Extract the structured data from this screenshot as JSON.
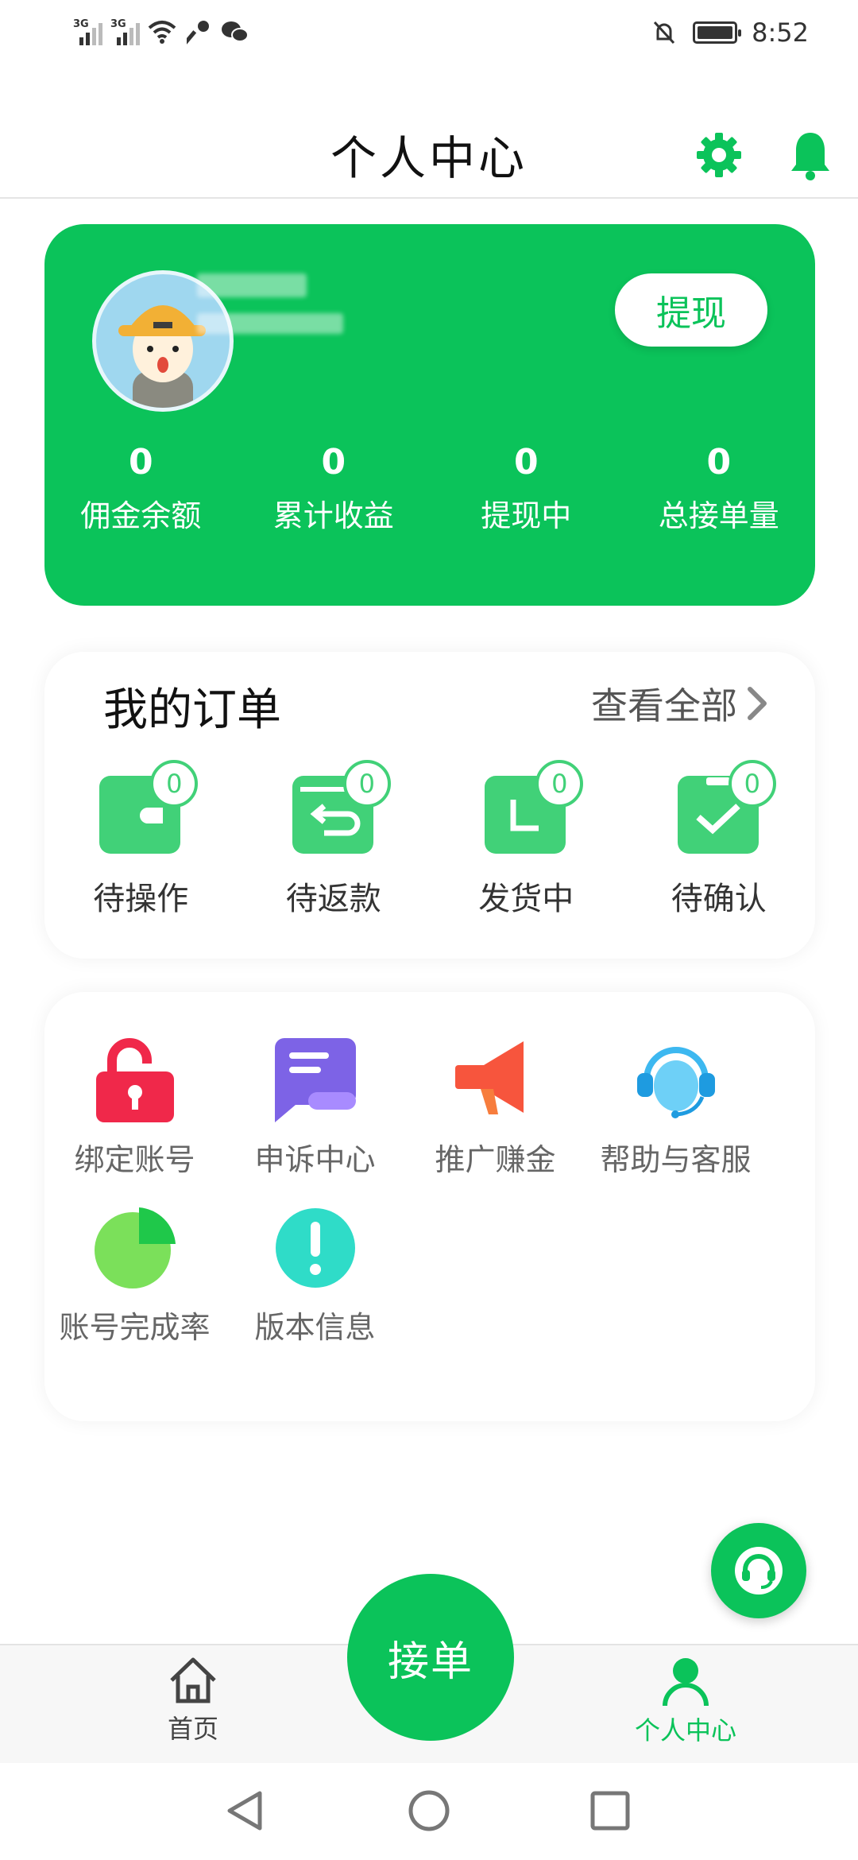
{
  "status_bar": {
    "network_1": "3G",
    "network_2": "3G",
    "time": "8:52"
  },
  "header": {
    "title": "个人中心"
  },
  "profile": {
    "withdraw_label": "提现",
    "stats": [
      {
        "value": "0",
        "label": "佣金余额"
      },
      {
        "value": "0",
        "label": "累计收益"
      },
      {
        "value": "0",
        "label": "提现中"
      },
      {
        "value": "0",
        "label": "总接单量"
      }
    ]
  },
  "orders": {
    "title": "我的订单",
    "view_all": "查看全部",
    "items": [
      {
        "label": "待操作",
        "count": "0",
        "icon": "wallet-icon"
      },
      {
        "label": "待返款",
        "count": "0",
        "icon": "refund-icon"
      },
      {
        "label": "发货中",
        "count": "0",
        "icon": "shipping-icon"
      },
      {
        "label": "待确认",
        "count": "0",
        "icon": "confirm-icon"
      }
    ]
  },
  "tools": {
    "items": [
      {
        "label": "绑定账号",
        "icon": "unlock-icon"
      },
      {
        "label": "申诉中心",
        "icon": "appeal-icon"
      },
      {
        "label": "推广赚金",
        "icon": "megaphone-icon"
      },
      {
        "label": "帮助与客服",
        "icon": "headset-agent-icon"
      },
      {
        "label": "账号完成率",
        "icon": "pie-chart-icon"
      },
      {
        "label": "版本信息",
        "icon": "info-exclamation-icon"
      }
    ]
  },
  "tab_bar": {
    "home": "首页",
    "center": "接单",
    "profile": "个人中心",
    "active_color": "#0bc35a"
  },
  "colors": {
    "accent": "#0bc35a",
    "order_icon": "#41d178"
  }
}
